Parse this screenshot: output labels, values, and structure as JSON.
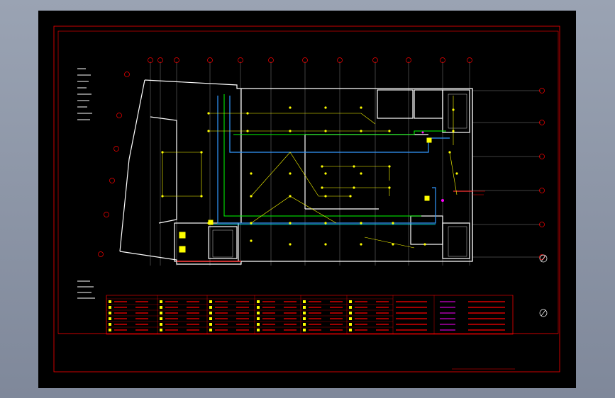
{
  "drawing": {
    "colors": {
      "background": "#000000",
      "frame": "#ff0000",
      "walls": "#ffffff",
      "grid_axis": "#b0b0b0",
      "lighting_circuit": "#ffff00",
      "cable_tray_green": "#00ff00",
      "cable_tray_blue": "#3399ff",
      "cable_tray_cyan": "#00ffff",
      "equipment": "#ff00ff",
      "notes": "#ff0000"
    },
    "icons": [
      "north-arrow-icon",
      "grid-bubble-icon",
      "light-fixture-icon",
      "panel-box-icon"
    ],
    "legend": {
      "columns": 8,
      "rows": 6
    }
  }
}
